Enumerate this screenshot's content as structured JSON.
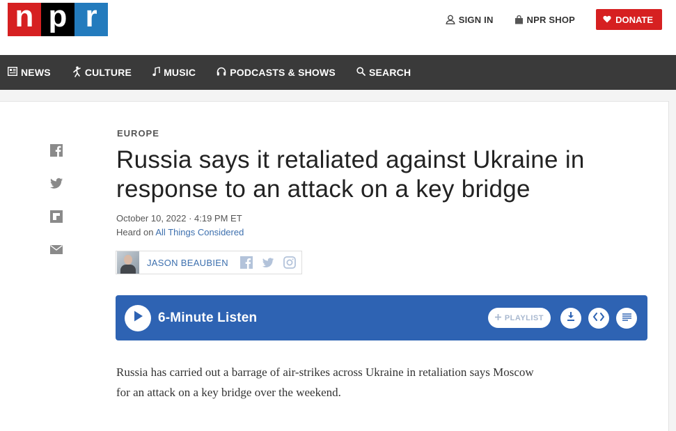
{
  "header": {
    "logo_letters": [
      "n",
      "p",
      "r"
    ],
    "sign_in_label": "SIGN IN",
    "shop_label": "NPR SHOP",
    "donate_label": "DONATE"
  },
  "nav": {
    "items": [
      {
        "label": "NEWS",
        "icon": "news-icon"
      },
      {
        "label": "CULTURE",
        "icon": "culture-icon"
      },
      {
        "label": "MUSIC",
        "icon": "music-note-icon"
      },
      {
        "label": "PODCASTS & SHOWS",
        "icon": "headphones-icon"
      },
      {
        "label": "SEARCH",
        "icon": "search-icon"
      }
    ]
  },
  "share": {
    "icons": [
      "facebook-icon",
      "twitter-icon",
      "flipboard-icon",
      "email-icon"
    ]
  },
  "article": {
    "slug": "EUROPE",
    "headline": "Russia says it retaliated against Ukraine in response to an attack on a key bridge",
    "date": "October 10, 2022 · 4:19 PM ET",
    "heard_on_prefix": "Heard on ",
    "program": "All Things Considered",
    "author": "JASON BEAUBIEN",
    "body": "Russia has carried out a barrage of air-strikes across Ukraine in retaliation says Moscow for an attack on a key bridge over the weekend."
  },
  "player": {
    "label": "6-Minute Listen",
    "playlist_label": "PLAYLIST",
    "color": "#2e63b3"
  },
  "colors": {
    "brand_red": "#d62021",
    "brand_blue": "#237bbd",
    "nav_bg": "#3a3a3a",
    "link": "#3c6fae"
  }
}
